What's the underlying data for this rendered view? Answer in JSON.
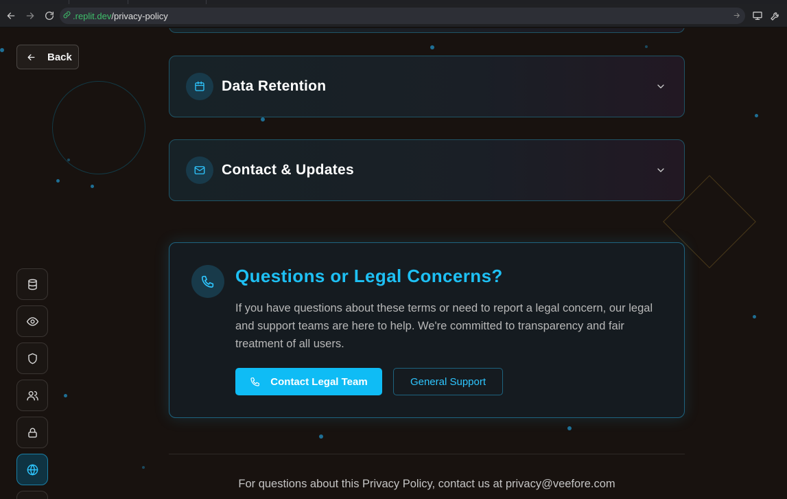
{
  "browser": {
    "url_domain": ".replit.dev",
    "url_path": "/privacy-policy"
  },
  "back": {
    "label": "Back"
  },
  "sections": [
    {
      "title": "Data Retention",
      "icon": "calendar-icon"
    },
    {
      "title": "Contact & Updates",
      "icon": "mail-icon"
    }
  ],
  "cta": {
    "title": "Questions or Legal Concerns?",
    "text": "If you have questions about these terms or need to report a legal concern, our legal and support teams are here to help. We're committed to transparency and fair treatment of all users.",
    "primary_label": "Contact Legal Team",
    "secondary_label": "General Support"
  },
  "footer": {
    "text": "For questions about this Privacy Policy, contact us at privacy@veefore.com"
  },
  "side_nav": {
    "items": [
      "database-icon",
      "eye-icon",
      "shield-icon",
      "users-icon",
      "lock-icon",
      "globe-icon"
    ],
    "active": "globe-icon"
  },
  "colors": {
    "accent": "#0fbcf5",
    "background": "#18120f",
    "card_border": "#1f5466"
  }
}
